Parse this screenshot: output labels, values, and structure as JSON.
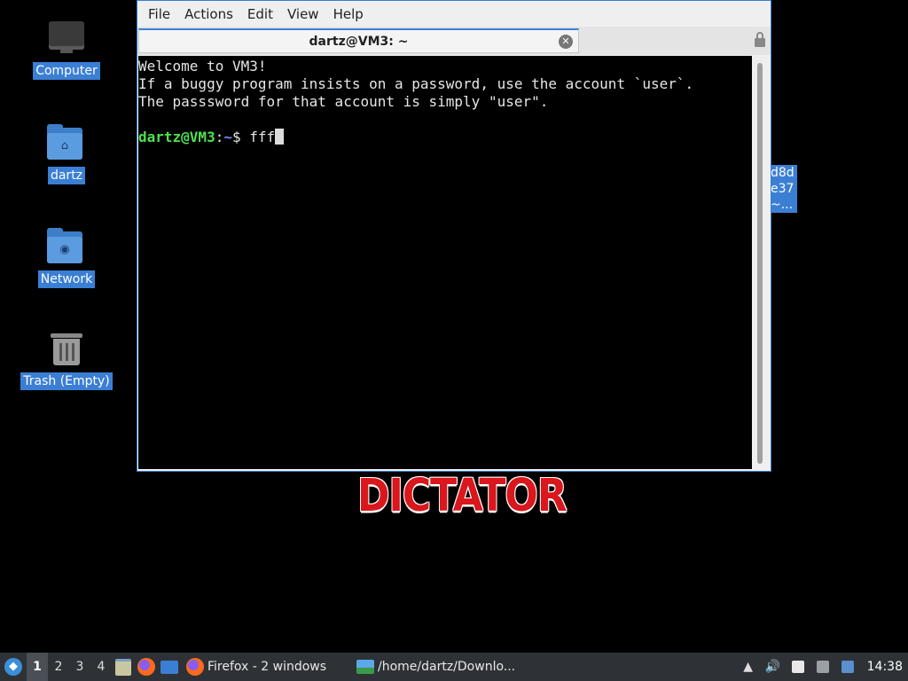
{
  "desktop": {
    "icons": [
      {
        "label": "Computer"
      },
      {
        "label": "dartz"
      },
      {
        "label": "Network"
      },
      {
        "label": "Trash (Empty)"
      }
    ],
    "partial_icon_lines": [
      "d8d",
      "e37",
      "~..."
    ],
    "wallpaper_text": "DICTATOR"
  },
  "window": {
    "menu": [
      "File",
      "Actions",
      "Edit",
      "View",
      "Help"
    ],
    "tab_title": "dartz@VM3: ~",
    "terminal": {
      "lines": [
        "Welcome to VM3!",
        "If a buggy program insists on a password, use the account `user`.",
        "The passsword for that account is simply \"user\".",
        ""
      ],
      "prompt_user": "dartz@VM3",
      "prompt_sep": ":",
      "prompt_path": "~",
      "prompt_symbol": "$ ",
      "input": "fff"
    }
  },
  "taskbar": {
    "workspaces": [
      "1",
      "2",
      "3",
      "4"
    ],
    "active_workspace": "1",
    "tasks": [
      {
        "label": "Firefox - 2 windows",
        "icon": "firefox-icon"
      },
      {
        "label": "/home/dartz/Downlo...",
        "icon": "image-viewer-icon"
      }
    ],
    "clock": "14:38"
  }
}
